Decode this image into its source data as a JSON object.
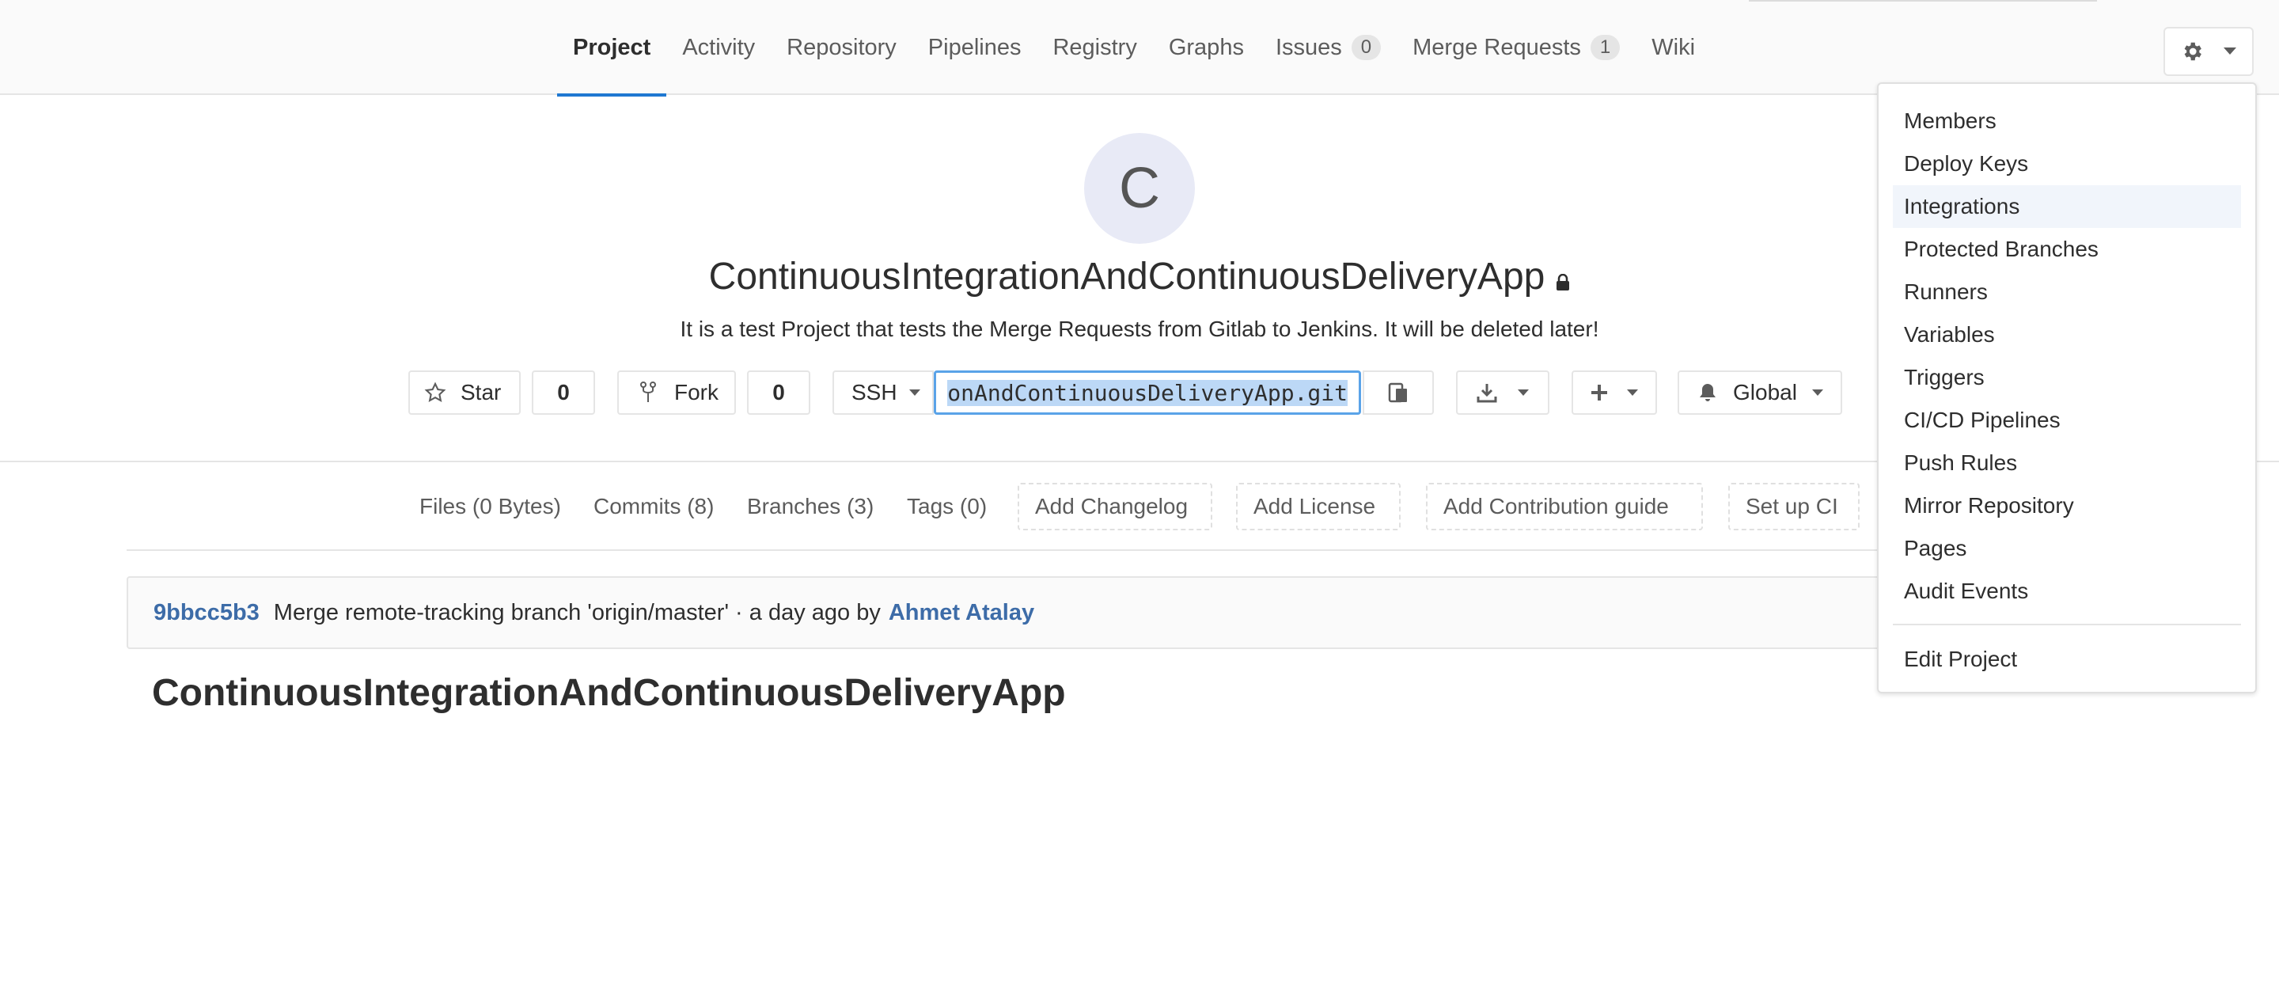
{
  "nav": {
    "tabs": [
      {
        "label": "Project"
      },
      {
        "label": "Activity"
      },
      {
        "label": "Repository"
      },
      {
        "label": "Pipelines"
      },
      {
        "label": "Registry"
      },
      {
        "label": "Graphs"
      },
      {
        "label": "Issues",
        "count": "0"
      },
      {
        "label": "Merge Requests",
        "count": "1"
      },
      {
        "label": "Wiki"
      }
    ],
    "active_tab": "Project",
    "settings_icon": "gear-icon"
  },
  "project": {
    "avatar_letter": "C",
    "title": "ContinuousIntegrationAndContinuousDeliveryApp",
    "description": "It is a test Project that tests the Merge Requests from Gitlab to Jenkins. It will be deleted later!"
  },
  "actions": {
    "star_label": "Star",
    "star_count": "0",
    "fork_label": "Fork",
    "fork_count": "0",
    "protocol": "SSH",
    "clone_url_visible": "onAndContinuousDeliveryApp.git",
    "notification_label": "Global"
  },
  "quick_links": [
    {
      "label": "Files (0 Bytes)"
    },
    {
      "label": "Commits (8)"
    },
    {
      "label": "Branches (3)"
    },
    {
      "label": "Tags (0)"
    },
    {
      "label": "Add Changelog"
    },
    {
      "label": "Add License"
    },
    {
      "label": "Add Contribution guide"
    },
    {
      "label": "Set up CI"
    }
  ],
  "commit": {
    "sha": "9bbcc5b3",
    "message": "Merge remote-tracking branch 'origin/master' · a day ago by",
    "author": "Ahmet Atalay"
  },
  "readme": {
    "title": "ContinuousIntegrationAndContinuousDeliveryApp"
  },
  "settings_menu": {
    "items": [
      {
        "label": "Members"
      },
      {
        "label": "Deploy Keys"
      },
      {
        "label": "Integrations"
      },
      {
        "label": "Protected Branches"
      },
      {
        "label": "Runners"
      },
      {
        "label": "Variables"
      },
      {
        "label": "Triggers"
      },
      {
        "label": "CI/CD Pipelines"
      },
      {
        "label": "Push Rules"
      },
      {
        "label": "Mirror Repository"
      },
      {
        "label": "Pages"
      },
      {
        "label": "Audit Events"
      }
    ],
    "highlighted": "Integrations",
    "footer_item": "Edit Project"
  },
  "colors": {
    "accent": "#1f78d1",
    "link": "#3d6ca8",
    "selection": "#bcd8f6"
  }
}
